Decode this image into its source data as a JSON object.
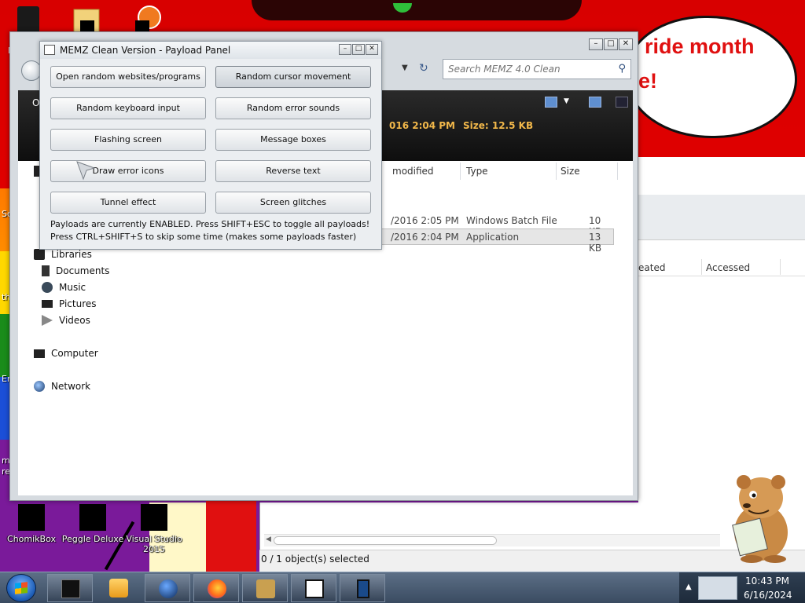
{
  "desktop": {
    "bubble_line1": "ride month",
    "bubble_line2": "e!",
    "edge_labels": [
      "So",
      "th",
      "Er",
      "m",
      "re"
    ],
    "top_label": "R",
    "icons": [
      {
        "label_line1": "ChomikBox",
        "label_line2": ""
      },
      {
        "label_line1": "Peggle Deluxe",
        "label_line2": ""
      },
      {
        "label_line1": "Visual Studio",
        "label_line2": "2015"
      }
    ]
  },
  "explorer": {
    "search_placeholder": "Search MEMZ 4.0 Clean",
    "cmdbar_label": "O",
    "details_date": "016 2:04 PM",
    "details_size": "Size:  12.5 KB",
    "nav": {
      "libraries": "Libraries",
      "documents": "Documents",
      "music": "Music",
      "pictures": "Pictures",
      "videos": "Videos",
      "computer": "Computer",
      "network": "Network"
    },
    "columns": {
      "modified": "modified",
      "type": "Type",
      "size": "Size"
    },
    "files": [
      {
        "modified": "/2016 2:05 PM",
        "type": "Windows Batch File",
        "size": "10 KB"
      },
      {
        "modified": "/2016 2:04 PM",
        "type": "Application",
        "size": "13 KB"
      }
    ]
  },
  "bgwindow": {
    "col_created": "eated",
    "col_accessed": "Accessed",
    "status": "0 / 1 object(s) selected"
  },
  "memz": {
    "title": "MEMZ Clean Version - Payload Panel",
    "buttons": {
      "open_random": "Open random websites/programs",
      "random_cursor": "Random cursor movement",
      "random_keyboard": "Random keyboard input",
      "random_error_sounds": "Random error sounds",
      "flashing_screen": "Flashing screen",
      "message_boxes": "Message boxes",
      "draw_error_icons": "Draw error icons",
      "reverse_text": "Reverse text",
      "tunnel_effect": "Tunnel effect",
      "screen_glitches": "Screen glitches"
    },
    "note1": "Payloads are currently ENABLED. Press SHIFT+ESC to toggle all payloads!",
    "note2": "Press CTRL+SHIFT+S to skip some time (makes some payloads faster)"
  },
  "taskbar": {
    "time": "10:43 PM",
    "date": "6/16/2024",
    "apps": [
      "media-center-icon",
      "media-player-icon",
      "globe-icon",
      "firefox-icon",
      "chomikbox-icon",
      "7zip-icon",
      "device-icon"
    ]
  },
  "colors": {
    "bubble_text": "#e01010",
    "details_text": "#f2b84a"
  }
}
